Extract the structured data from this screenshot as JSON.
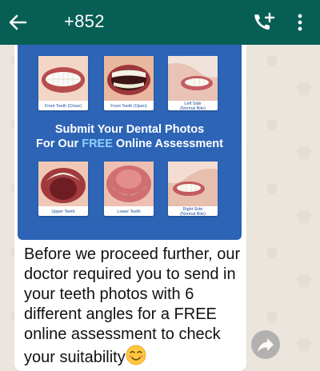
{
  "header": {
    "title": "+852",
    "icons": {
      "back": "arrow-left-icon",
      "call": "add-call-icon",
      "menu": "more-vert-icon"
    },
    "bar_color": "#075e54"
  },
  "card": {
    "background_color": "#2d64b6",
    "top_row": [
      {
        "caption": "Front Teeth (Close)"
      },
      {
        "caption": "Front Teeth (Open)"
      },
      {
        "caption_line1": "Left Side",
        "caption_line2": "(Normal Bite)"
      }
    ],
    "headline_line1": "Submit Your Dental Photos",
    "headline_line2_pre": "For Our",
    "headline_line2_free": "FREE",
    "headline_line2_post": "Online Assessment",
    "bottom_row": [
      {
        "caption": "Upper Teeth"
      },
      {
        "caption": "Lower Teeth"
      },
      {
        "caption_line1": "Right Side",
        "caption_line2": "(Normal Bite)"
      }
    ]
  },
  "message": {
    "text": "Before we proceed further, our doctor required you to send in your teeth photos with 6 different angles for a FREE online assessment to check your suitability",
    "emoji": "smiling-blush-emoji"
  },
  "share": {
    "icon": "share-forward-icon"
  }
}
